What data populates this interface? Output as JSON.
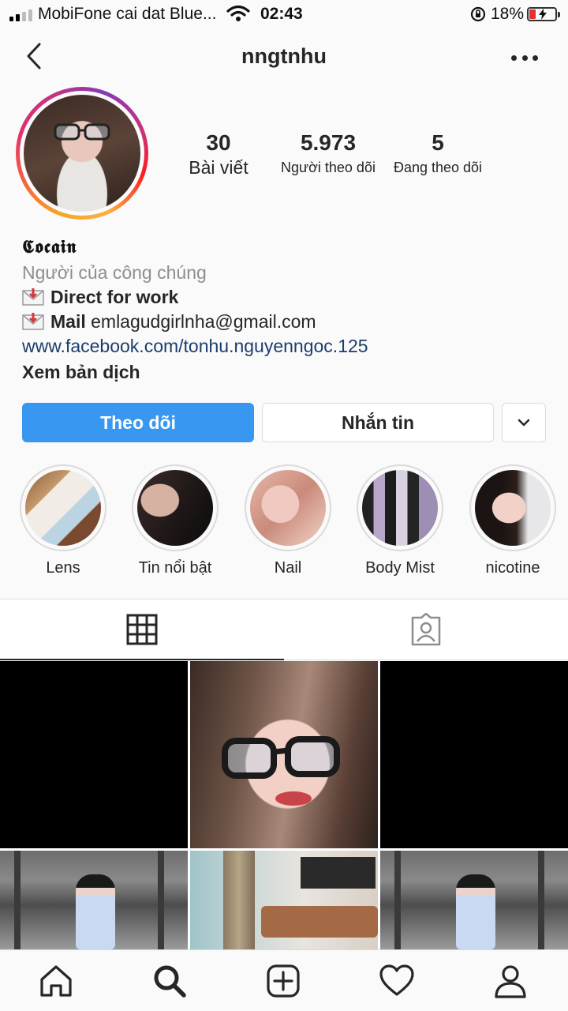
{
  "status_bar": {
    "carrier": "MobiFone cai dat Blue...",
    "time": "02:43",
    "battery": "18%",
    "battery_level": 0.18
  },
  "header": {
    "username": "nngtnhu",
    "back_icon": "chevron-left-icon",
    "more_icon": "more-horizontal-icon"
  },
  "stats": {
    "posts": {
      "value": "30",
      "label": "Bài viết"
    },
    "followers": {
      "value": "5.973",
      "label": "Người theo dõi"
    },
    "following": {
      "value": "5",
      "label": "Đang theo dõi"
    }
  },
  "bio": {
    "name": "𝕮𝖔𝖈𝖆𝖎𝖓",
    "category": "Người của công chúng",
    "line1": "Direct for work",
    "line2_bold": "Mail",
    "line2_text": " emlagudgirlnha@gmail.com",
    "link": "www.facebook.com/tonhu.nguyenngoc.125",
    "translate": "Xem bản dịch"
  },
  "actions": {
    "follow": "Theo dõi",
    "message": "Nhắn tin",
    "follow_color": "#3897f0"
  },
  "highlights": [
    {
      "label": "Lens"
    },
    {
      "label": "Tin nổi bật"
    },
    {
      "label": "Nail"
    },
    {
      "label": "Body Mist"
    },
    {
      "label": "nicotine"
    }
  ],
  "tabs": {
    "grid_icon": "grid-icon",
    "tagged_icon": "tagged-person-icon"
  },
  "bottom_nav": [
    "home-icon",
    "search-icon",
    "add-post-icon",
    "heart-icon",
    "profile-icon"
  ]
}
